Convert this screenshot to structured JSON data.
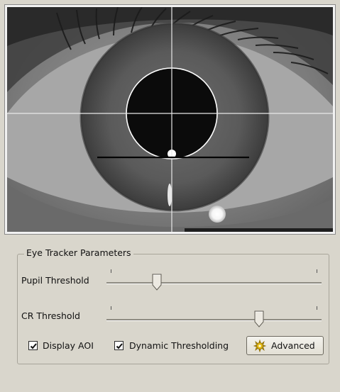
{
  "viewer": {
    "image_label": "Infrared eye camera view"
  },
  "parameters": {
    "group_title": "Eye Tracker Parameters",
    "pupil_threshold": {
      "label": "Pupil Threshold",
      "value": 0.22
    },
    "cr_threshold": {
      "label": "CR Threshold",
      "value": 0.72
    },
    "display_aoi": {
      "label": "Display AOI",
      "checked": true
    },
    "dynamic_thresholding": {
      "label": "Dynamic Thresholding",
      "checked": true
    },
    "advanced_button": {
      "label": "Advanced",
      "icon": "gear-sparkle-icon"
    }
  }
}
